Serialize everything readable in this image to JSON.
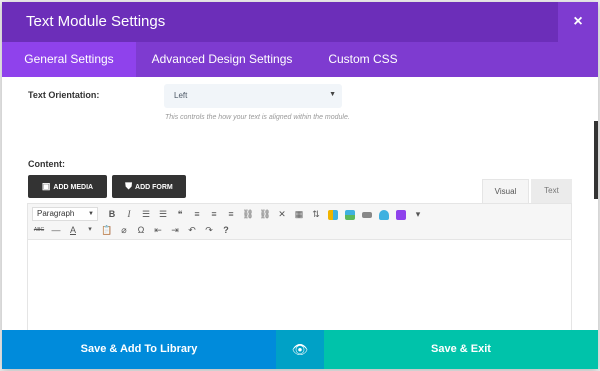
{
  "header": {
    "title": "Text Module Settings",
    "close_icon": "×"
  },
  "tabs": [
    {
      "label": "General Settings"
    },
    {
      "label": "Advanced Design Settings"
    },
    {
      "label": "Custom CSS"
    }
  ],
  "orientation": {
    "label": "Text Orientation:",
    "value": "Left",
    "description": "This controls the how your text is aligned within the module."
  },
  "content": {
    "label": "Content:",
    "add_media": "ADD MEDIA",
    "add_form": "ADD FORM",
    "visual_tab": "Visual",
    "text_tab": "Text"
  },
  "toolbar": {
    "format": "Paragraph",
    "row1": [
      "B",
      "I",
      "☰",
      "☰",
      "❝",
      "≡",
      "≡",
      "≡",
      "⛓",
      "⛓",
      "✕",
      "▦",
      "⇅"
    ],
    "row2": [
      "ABC",
      "—",
      "A",
      "▾",
      "📋",
      "⌀",
      "Ω",
      "⇤",
      "⇥",
      "↶",
      "↷",
      "?"
    ]
  },
  "footer": {
    "library_label": "Save & Add To Library",
    "eye_icon": "👁",
    "save_label": "Save & Exit"
  },
  "colors": {
    "header": "#6c2eb9",
    "tab_bar": "#7e3bd0",
    "tab_active": "#8f42ec",
    "library": "#008bdb",
    "preview": "#00a1c6",
    "save": "#00c3aa"
  }
}
